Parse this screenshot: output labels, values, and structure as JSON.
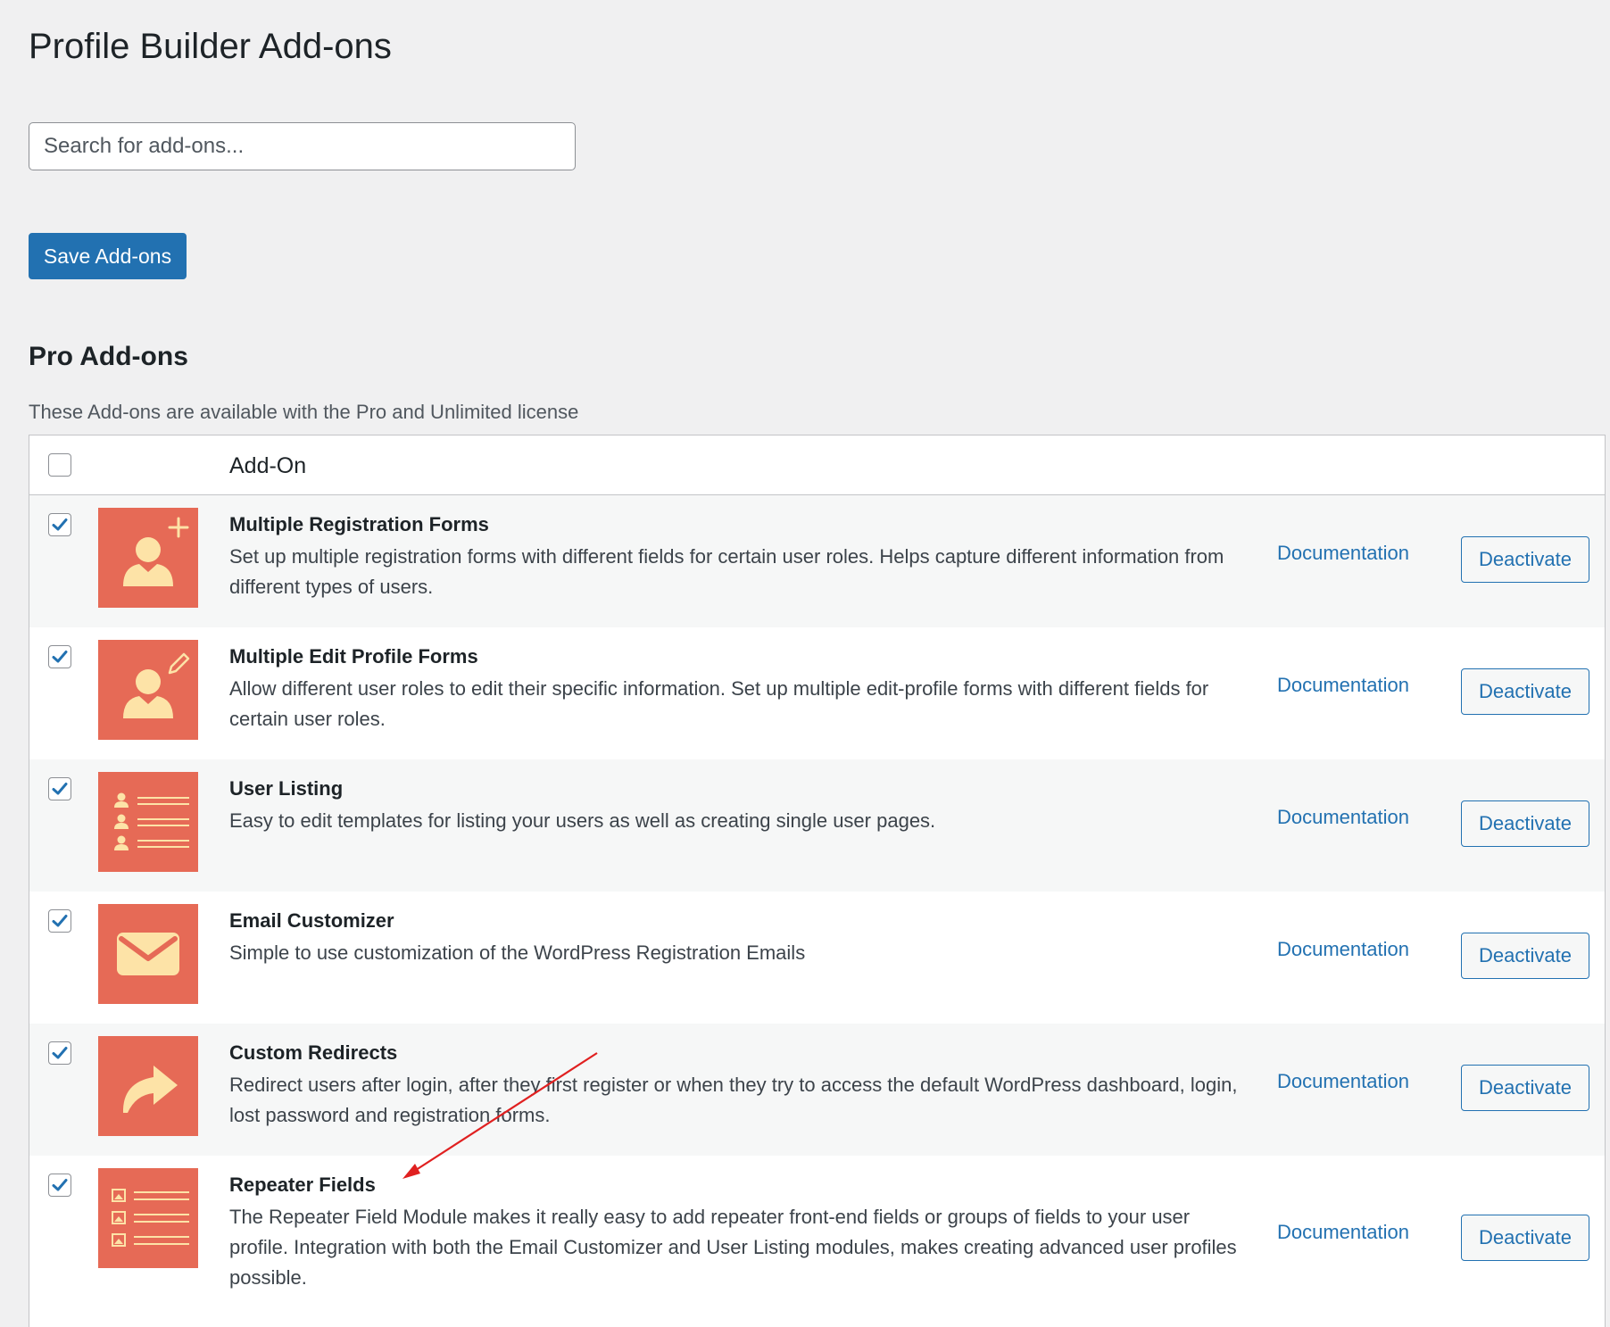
{
  "page": {
    "title": "Profile Builder Add-ons"
  },
  "search": {
    "placeholder": "Search for add-ons..."
  },
  "toolbar": {
    "save_label": "Save Add-ons"
  },
  "section": {
    "title": "Pro Add-ons",
    "description": "These Add-ons are available with the Pro and Unlimited license"
  },
  "table": {
    "header": {
      "select_all_checked": false,
      "column_label": "Add-On"
    },
    "rows": [
      {
        "checked": true,
        "icon": "user-plus-icon",
        "name": "Multiple Registration Forms",
        "description": "Set up multiple registration forms with different fields for certain user roles. Helps capture different information from different types of users.",
        "doc_label": "Documentation",
        "action_label": "Deactivate"
      },
      {
        "checked": true,
        "icon": "user-edit-icon",
        "name": "Multiple Edit Profile Forms",
        "description": "Allow different user roles to edit their specific information. Set up multiple edit-profile forms with different fields for certain user roles.",
        "doc_label": "Documentation",
        "action_label": "Deactivate"
      },
      {
        "checked": true,
        "icon": "user-list-icon",
        "name": "User Listing",
        "description": "Easy to edit templates for listing your users as well as creating single user pages.",
        "doc_label": "Documentation",
        "action_label": "Deactivate"
      },
      {
        "checked": true,
        "icon": "envelope-icon",
        "name": "Email Customizer",
        "description": "Simple to use customization of the WordPress Registration Emails",
        "doc_label": "Documentation",
        "action_label": "Deactivate"
      },
      {
        "checked": true,
        "icon": "redirect-arrow-icon",
        "name": "Custom Redirects",
        "description": "Redirect users after login, after they first register or when they try to access the default WordPress dashboard, login, lost password and registration forms.",
        "doc_label": "Documentation",
        "action_label": "Deactivate"
      },
      {
        "checked": true,
        "icon": "repeater-fields-icon",
        "name": "Repeater Fields",
        "description": "The Repeater Field Module makes it really easy to add repeater front-end fields or groups of fields to your user profile. Integration with both the Email Customizer and User Listing modules, makes creating advanced user profiles possible.",
        "doc_label": "Documentation",
        "action_label": "Deactivate"
      }
    ]
  },
  "colors": {
    "accent": "#2271b1",
    "icon_bg": "#e66a56",
    "icon_fg": "#fde3a7",
    "annotation_arrow": "#e02020"
  }
}
